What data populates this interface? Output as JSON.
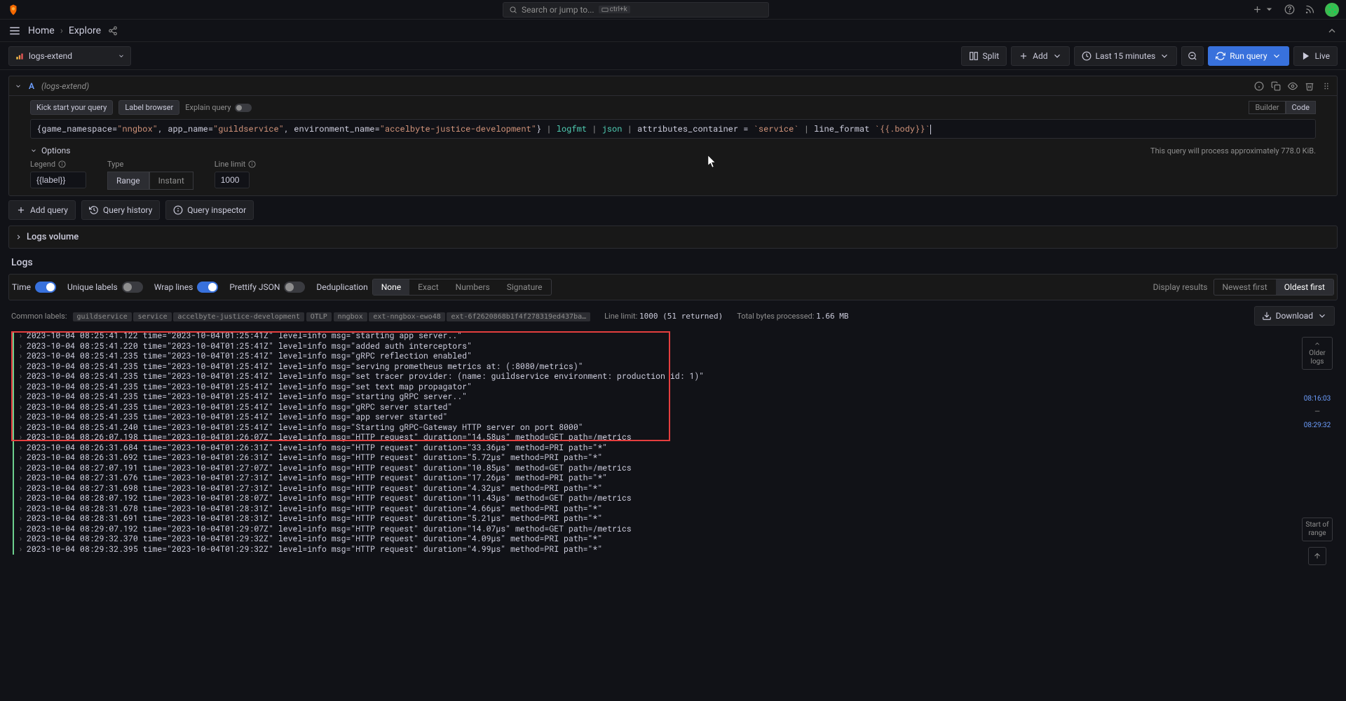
{
  "topbar": {
    "search_placeholder": "Search or jump to...",
    "kbd": "ctrl+k"
  },
  "breadcrumb": {
    "home": "Home",
    "explore": "Explore"
  },
  "toolbar": {
    "datasource": "logs-extend",
    "split": "Split",
    "add": "Add",
    "timerange": "Last 15 minutes",
    "run": "Run query",
    "live": "Live"
  },
  "query": {
    "letter": "A",
    "ds": "(logs-extend)",
    "kickstart": "Kick start your query",
    "labelbrowser": "Label browser",
    "explain": "Explain query",
    "builder": "Builder",
    "code": "Code",
    "options_label": "Options",
    "hint": "This query will process approximately 778.0 KiB.",
    "legend_label": "Legend",
    "legend_value": "{{label}}",
    "type_label": "Type",
    "type_range": "Range",
    "type_instant": "Instant",
    "linelimit_label": "Line limit",
    "linelimit_value": "1000"
  },
  "actions": {
    "add_query": "Add query",
    "history": "Query history",
    "inspector": "Query inspector"
  },
  "logsvolume": "Logs volume",
  "logs_title": "Logs",
  "logs_ctrl": {
    "time": "Time",
    "unique": "Unique labels",
    "wrap": "Wrap lines",
    "prettify": "Prettify JSON",
    "dedup": "Deduplication",
    "dedup_none": "None",
    "dedup_exact": "Exact",
    "dedup_numbers": "Numbers",
    "dedup_signature": "Signature",
    "display": "Display results",
    "newest": "Newest first",
    "oldest": "Oldest first"
  },
  "labels": {
    "title": "Common labels:",
    "tags": [
      "guildservice",
      "service",
      "accelbyte-justice-development",
      "OTLP",
      "nngbox",
      "ext-nngbox-ewo48",
      "ext-6f2620868b1f4f278319ed437ba…"
    ],
    "linelimit_label": "Line limit:",
    "linelimit_val": "1000 (51 returned)",
    "bytes_label": "Total bytes processed:",
    "bytes_val": "1.66 MB",
    "download": "Download"
  },
  "log_lines": [
    "2023-10-04 08:25:41.122 time=\"2023-10-04T01:25:41Z\" level=info msg=\"starting app server..\"",
    "2023-10-04 08:25:41.220 time=\"2023-10-04T01:25:41Z\" level=info msg=\"added auth interceptors\"",
    "2023-10-04 08:25:41.235 time=\"2023-10-04T01:25:41Z\" level=info msg=\"gRPC reflection enabled\"",
    "2023-10-04 08:25:41.235 time=\"2023-10-04T01:25:41Z\" level=info msg=\"serving prometheus metrics at: (:8080/metrics)\"",
    "2023-10-04 08:25:41.235 time=\"2023-10-04T01:25:41Z\" level=info msg=\"set tracer provider: (name: guildservice environment: production id: 1)\"",
    "2023-10-04 08:25:41.235 time=\"2023-10-04T01:25:41Z\" level=info msg=\"set text map propagator\"",
    "2023-10-04 08:25:41.235 time=\"2023-10-04T01:25:41Z\" level=info msg=\"starting gRPC server..\"",
    "2023-10-04 08:25:41.235 time=\"2023-10-04T01:25:41Z\" level=info msg=\"gRPC server started\"",
    "2023-10-04 08:25:41.235 time=\"2023-10-04T01:25:41Z\" level=info msg=\"app server started\"",
    "2023-10-04 08:25:41.240 time=\"2023-10-04T01:25:41Z\" level=info msg=\"Starting gRPC-Gateway HTTP server on port 8000\"",
    "2023-10-04 08:26:07.198 time=\"2023-10-04T01:26:07Z\" level=info msg=\"HTTP request\" duration=\"14.58µs\" method=GET path=/metrics",
    "2023-10-04 08:26:31.684 time=\"2023-10-04T01:26:31Z\" level=info msg=\"HTTP request\" duration=\"33.36µs\" method=PRI path=\"*\"",
    "2023-10-04 08:26:31.692 time=\"2023-10-04T01:26:31Z\" level=info msg=\"HTTP request\" duration=\"5.72µs\" method=PRI path=\"*\"",
    "2023-10-04 08:27:07.191 time=\"2023-10-04T01:27:07Z\" level=info msg=\"HTTP request\" duration=\"10.85µs\" method=GET path=/metrics",
    "2023-10-04 08:27:31.676 time=\"2023-10-04T01:27:31Z\" level=info msg=\"HTTP request\" duration=\"17.26µs\" method=PRI path=\"*\"",
    "2023-10-04 08:27:31.698 time=\"2023-10-04T01:27:31Z\" level=info msg=\"HTTP request\" duration=\"4.32µs\" method=PRI path=\"*\"",
    "2023-10-04 08:28:07.192 time=\"2023-10-04T01:28:07Z\" level=info msg=\"HTTP request\" duration=\"11.43µs\" method=GET path=/metrics",
    "2023-10-04 08:28:31.678 time=\"2023-10-04T01:28:31Z\" level=info msg=\"HTTP request\" duration=\"4.66µs\" method=PRI path=\"*\"",
    "2023-10-04 08:28:31.691 time=\"2023-10-04T01:28:31Z\" level=info msg=\"HTTP request\" duration=\"5.21µs\" method=PRI path=\"*\"",
    "2023-10-04 08:29:07.192 time=\"2023-10-04T01:29:07Z\" level=info msg=\"HTTP request\" duration=\"14.07µs\" method=GET path=/metrics",
    "2023-10-04 08:29:32.370 time=\"2023-10-04T01:29:32Z\" level=info msg=\"HTTP request\" duration=\"4.09µs\" method=PRI path=\"*\"",
    "2023-10-04 08:29:32.395 time=\"2023-10-04T01:29:32Z\" level=info msg=\"HTTP request\" duration=\"4.99µs\" method=PRI path=\"*\""
  ],
  "lognav": {
    "older": "Older logs",
    "start": "Start of range",
    "t1": "08:16:03",
    "dash": "—",
    "t2": "08:29:32"
  }
}
